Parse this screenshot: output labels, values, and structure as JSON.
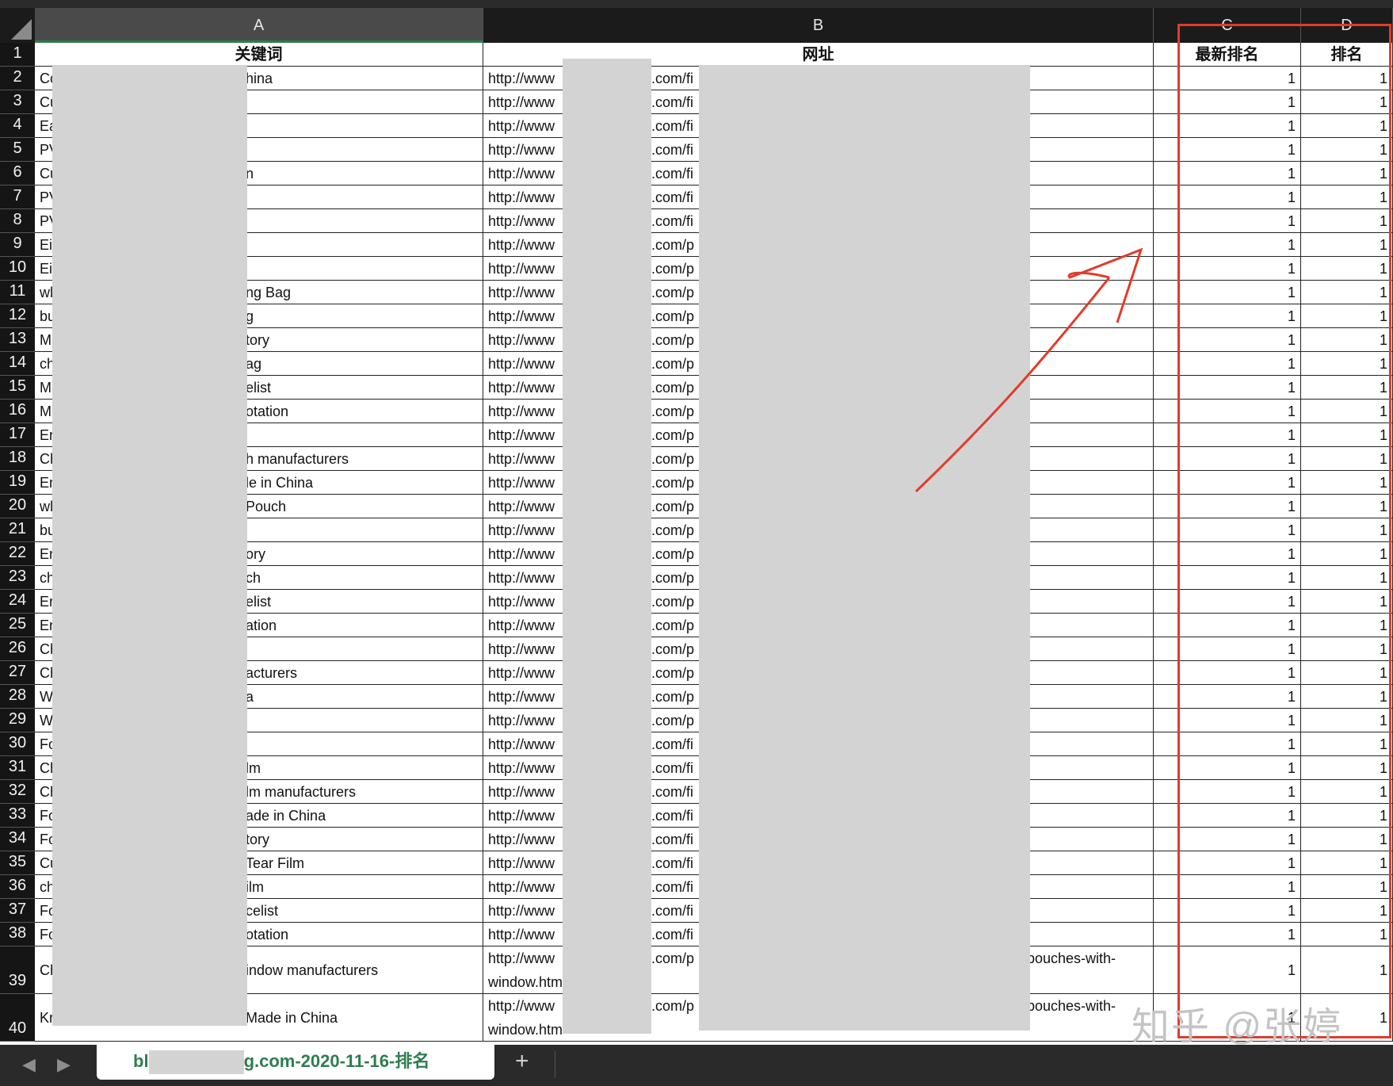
{
  "columns": [
    "A",
    "B",
    "C",
    "D"
  ],
  "header_row": {
    "row_num": "1",
    "keyword": "关键词",
    "url": "网址",
    "latest_rank": "最新排名",
    "rank": "排名"
  },
  "rows": [
    {
      "n": "2",
      "kw_prefix": "Co",
      "kw_suffix": "hina",
      "url_prefix": "http://www",
      "url_mid": ".com/fi",
      "url_tail": "",
      "c": "1",
      "d": "1"
    },
    {
      "n": "3",
      "kw_prefix": "Cu",
      "kw_suffix": "",
      "url_prefix": "http://www",
      "url_mid": ".com/fi",
      "url_tail": "",
      "c": "1",
      "d": "1"
    },
    {
      "n": "4",
      "kw_prefix": "Ea",
      "kw_suffix": "",
      "url_prefix": "http://www",
      "url_mid": ".com/fi",
      "url_tail": "",
      "c": "1",
      "d": "1"
    },
    {
      "n": "5",
      "kw_prefix": "PV",
      "kw_suffix": "",
      "url_prefix": "http://www",
      "url_mid": ".com/fi",
      "url_tail": "",
      "c": "1",
      "d": "1"
    },
    {
      "n": "6",
      "kw_prefix": "Cu",
      "kw_suffix": "n",
      "url_prefix": "http://www",
      "url_mid": ".com/fi",
      "url_tail": "",
      "c": "1",
      "d": "1"
    },
    {
      "n": "7",
      "kw_prefix": "PV",
      "kw_suffix": "",
      "url_prefix": "http://www",
      "url_mid": ".com/fi",
      "url_tail": "",
      "c": "1",
      "d": "1"
    },
    {
      "n": "8",
      "kw_prefix": "PV",
      "kw_suffix": "",
      "url_prefix": "http://www",
      "url_mid": ".com/fi",
      "url_tail": "",
      "c": "1",
      "d": "1"
    },
    {
      "n": "9",
      "kw_prefix": "Ei",
      "kw_suffix": "",
      "url_prefix": "http://www",
      "url_mid": ".com/p",
      "url_tail": "",
      "c": "1",
      "d": "1"
    },
    {
      "n": "10",
      "kw_prefix": "Ei",
      "kw_suffix": "",
      "url_prefix": "http://www",
      "url_mid": ".com/p",
      "url_tail": "",
      "c": "1",
      "d": "1"
    },
    {
      "n": "11",
      "kw_prefix": "wl",
      "kw_suffix": "ng Bag",
      "url_prefix": "http://www",
      "url_mid": ".com/p",
      "url_tail": "",
      "c": "1",
      "d": "1"
    },
    {
      "n": "12",
      "kw_prefix": "bu",
      "kw_suffix": "g",
      "url_prefix": "http://www",
      "url_mid": ".com/p",
      "url_tail": "",
      "c": "1",
      "d": "1"
    },
    {
      "n": "13",
      "kw_prefix": "M",
      "kw_suffix": "tory",
      "url_prefix": "http://www",
      "url_mid": ".com/p",
      "url_tail": "",
      "c": "1",
      "d": "1"
    },
    {
      "n": "14",
      "kw_prefix": "ch",
      "kw_suffix": "ag",
      "url_prefix": "http://www",
      "url_mid": ".com/p",
      "url_tail": "",
      "c": "1",
      "d": "1"
    },
    {
      "n": "15",
      "kw_prefix": "M",
      "kw_suffix": "elist",
      "url_prefix": "http://www",
      "url_mid": ".com/p",
      "url_tail": "",
      "c": "1",
      "d": "1"
    },
    {
      "n": "16",
      "kw_prefix": "M",
      "kw_suffix": "otation",
      "url_prefix": "http://www",
      "url_mid": ".com/p",
      "url_tail": "",
      "c": "1",
      "d": "1"
    },
    {
      "n": "17",
      "kw_prefix": "Er",
      "kw_suffix": "",
      "url_prefix": "http://www",
      "url_mid": ".com/p",
      "url_tail": "",
      "c": "1",
      "d": "1"
    },
    {
      "n": "18",
      "kw_prefix": "Ch",
      "kw_suffix": "h manufacturers",
      "url_prefix": "http://www",
      "url_mid": ".com/p",
      "url_tail": "",
      "c": "1",
      "d": "1"
    },
    {
      "n": "19",
      "kw_prefix": "Er",
      "kw_suffix": "le in China",
      "url_prefix": "http://www",
      "url_mid": ".com/p",
      "url_tail": "",
      "c": "1",
      "d": "1"
    },
    {
      "n": "20",
      "kw_prefix": "wl",
      "kw_suffix": "Pouch",
      "url_prefix": "http://www",
      "url_mid": ".com/p",
      "url_tail": "",
      "c": "1",
      "d": "1"
    },
    {
      "n": "21",
      "kw_prefix": "bu",
      "kw_suffix": "",
      "url_prefix": "http://www",
      "url_mid": ".com/p",
      "url_tail": "",
      "c": "1",
      "d": "1"
    },
    {
      "n": "22",
      "kw_prefix": "Er",
      "kw_suffix": "ory",
      "url_prefix": "http://www",
      "url_mid": ".com/p",
      "url_tail": "",
      "c": "1",
      "d": "1"
    },
    {
      "n": "23",
      "kw_prefix": "ch",
      "kw_suffix": "ch",
      "url_prefix": "http://www",
      "url_mid": ".com/p",
      "url_tail": "",
      "c": "1",
      "d": "1"
    },
    {
      "n": "24",
      "kw_prefix": "Er",
      "kw_suffix": "elist",
      "url_prefix": "http://www",
      "url_mid": ".com/p",
      "url_tail": "",
      "c": "1",
      "d": "1"
    },
    {
      "n": "25",
      "kw_prefix": "Er",
      "kw_suffix": "ation",
      "url_prefix": "http://www",
      "url_mid": ".com/p",
      "url_tail": "",
      "c": "1",
      "d": "1"
    },
    {
      "n": "26",
      "kw_prefix": "Ch",
      "kw_suffix": "",
      "url_prefix": "http://www",
      "url_mid": ".com/p",
      "url_tail": "",
      "c": "1",
      "d": "1"
    },
    {
      "n": "27",
      "kw_prefix": "Ch",
      "kw_suffix": "acturers",
      "url_prefix": "http://www",
      "url_mid": ".com/p",
      "url_tail": "",
      "c": "1",
      "d": "1"
    },
    {
      "n": "28",
      "kw_prefix": "W",
      "kw_suffix": "a",
      "url_prefix": "http://www",
      "url_mid": ".com/p",
      "url_tail": "",
      "c": "1",
      "d": "1"
    },
    {
      "n": "29",
      "kw_prefix": "W",
      "kw_suffix": "",
      "url_prefix": "http://www",
      "url_mid": ".com/p",
      "url_tail": "",
      "c": "1",
      "d": "1"
    },
    {
      "n": "30",
      "kw_prefix": "Fo",
      "kw_suffix": "",
      "url_prefix": "http://www",
      "url_mid": ".com/fi",
      "url_tail": "",
      "c": "1",
      "d": "1"
    },
    {
      "n": "31",
      "kw_prefix": "Ch",
      "kw_suffix": "lm",
      "url_prefix": "http://www",
      "url_mid": ".com/fi",
      "url_tail": "",
      "c": "1",
      "d": "1"
    },
    {
      "n": "32",
      "kw_prefix": "Ch",
      "kw_suffix": "lm manufacturers",
      "url_prefix": "http://www",
      "url_mid": ".com/fi",
      "url_tail": "",
      "c": "1",
      "d": "1"
    },
    {
      "n": "33",
      "kw_prefix": "Fo",
      "kw_suffix": "ade in China",
      "url_prefix": "http://www",
      "url_mid": ".com/fi",
      "url_tail": "",
      "c": "1",
      "d": "1"
    },
    {
      "n": "34",
      "kw_prefix": "Fo",
      "kw_suffix": "tory",
      "url_prefix": "http://www",
      "url_mid": ".com/fi",
      "url_tail": "",
      "c": "1",
      "d": "1"
    },
    {
      "n": "35",
      "kw_prefix": "Cu",
      "kw_suffix": "Tear Film",
      "url_prefix": "http://www",
      "url_mid": ".com/fi",
      "url_tail": "",
      "c": "1",
      "d": "1"
    },
    {
      "n": "36",
      "kw_prefix": "ch",
      "kw_suffix": "ilm",
      "url_prefix": "http://www",
      "url_mid": ".com/fi",
      "url_tail": "",
      "c": "1",
      "d": "1"
    },
    {
      "n": "37",
      "kw_prefix": "Fo",
      "kw_suffix": "celist",
      "url_prefix": "http://www",
      "url_mid": ".com/fi",
      "url_tail": "",
      "c": "1",
      "d": "1"
    },
    {
      "n": "38",
      "kw_prefix": "Fo",
      "kw_suffix": "otation",
      "url_prefix": "http://www",
      "url_mid": ".com/fi",
      "url_tail": "",
      "c": "1",
      "d": "1"
    },
    {
      "n": "39",
      "kw_prefix": "Ch",
      "kw_suffix": "indow manufacturers",
      "url_prefix": "http://www",
      "url_line2": "window.htm",
      "url_mid": ".com/p",
      "url_tail": "-pouches-with-",
      "c": "1",
      "d": "1",
      "tall": true
    },
    {
      "n": "40",
      "kw_prefix": "Kr",
      "kw_suffix": "Made in China",
      "url_prefix": "http://www",
      "url_line2": "window.htm",
      "url_mid": ".com/p",
      "url_tail": "-pouches-with-",
      "c": "1",
      "d": "1",
      "tall": true
    }
  ],
  "sheet_tab": {
    "prefix": "bl",
    "suffix": "g.com-2020-11-16-排名"
  },
  "add_sheet_label": "+",
  "nav": {
    "prev": "◀",
    "next": "▶"
  },
  "watermark": "知乎 @张婷",
  "colors": {
    "header_bg": "#1b1b1b",
    "active_col": "#4a4a4a",
    "tab_text": "#2e7d4f",
    "annotation_red": "#e23b2a",
    "redaction": "#d3d3d3"
  },
  "icons": [
    "select-all-triangle-icon",
    "arrow-annotation-icon"
  ]
}
